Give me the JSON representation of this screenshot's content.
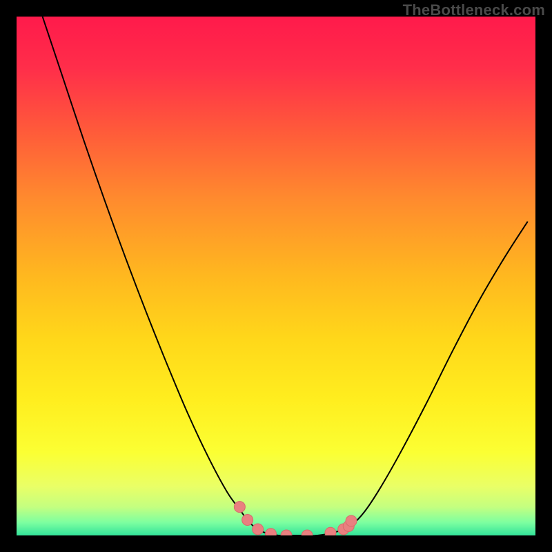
{
  "watermark": "TheBottleneck.com",
  "colors": {
    "frame": "#000000",
    "curve": "#000000",
    "marker_fill": "#e98080",
    "marker_stroke": "#d86a6a",
    "gradient_stops": [
      {
        "offset": 0.0,
        "color": "#ff1a4b"
      },
      {
        "offset": 0.1,
        "color": "#ff2e4a"
      },
      {
        "offset": 0.22,
        "color": "#ff5a3a"
      },
      {
        "offset": 0.35,
        "color": "#ff8a2e"
      },
      {
        "offset": 0.5,
        "color": "#ffb81f"
      },
      {
        "offset": 0.62,
        "color": "#ffd71a"
      },
      {
        "offset": 0.74,
        "color": "#ffee1f"
      },
      {
        "offset": 0.84,
        "color": "#fbff33"
      },
      {
        "offset": 0.905,
        "color": "#eaff66"
      },
      {
        "offset": 0.945,
        "color": "#c4ff80"
      },
      {
        "offset": 0.975,
        "color": "#7dffa0"
      },
      {
        "offset": 1.0,
        "color": "#33e39a"
      }
    ]
  },
  "chart_data": {
    "type": "line",
    "title": "",
    "xlabel": "",
    "ylabel": "",
    "xlim": [
      0,
      1
    ],
    "ylim": [
      0,
      1
    ],
    "series": [
      {
        "name": "bottleneck-curve",
        "x": [
          0.05,
          0.09,
          0.13,
          0.17,
          0.21,
          0.25,
          0.29,
          0.33,
          0.37,
          0.405,
          0.43,
          0.445,
          0.46,
          0.48,
          0.505,
          0.54,
          0.58,
          0.62,
          0.645,
          0.67,
          0.7,
          0.74,
          0.79,
          0.84,
          0.89,
          0.94,
          0.985
        ],
        "y": [
          1.0,
          0.88,
          0.76,
          0.645,
          0.535,
          0.43,
          0.33,
          0.235,
          0.15,
          0.085,
          0.05,
          0.03,
          0.015,
          0.005,
          0.0,
          0.0,
          0.0,
          0.008,
          0.02,
          0.045,
          0.09,
          0.16,
          0.255,
          0.355,
          0.45,
          0.535,
          0.605
        ]
      }
    ],
    "markers": {
      "name": "highlight-points",
      "x": [
        0.43,
        0.445,
        0.465,
        0.49,
        0.52,
        0.56,
        0.605,
        0.63,
        0.64,
        0.645
      ],
      "y": [
        0.055,
        0.03,
        0.012,
        0.003,
        0.0,
        0.0,
        0.005,
        0.012,
        0.018,
        0.028
      ]
    }
  }
}
